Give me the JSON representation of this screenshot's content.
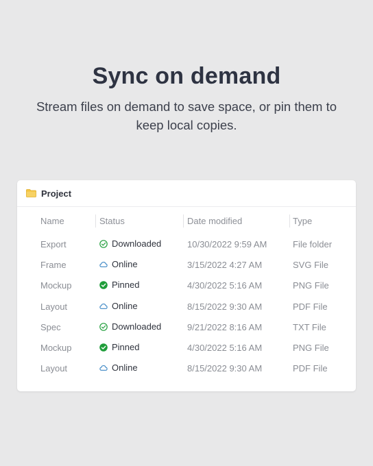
{
  "hero": {
    "title": "Sync on demand",
    "subtitle": "Stream files on demand to save space, or pin them to keep local copies."
  },
  "explorer": {
    "folder_name": "Project",
    "folder_icon": "folder-icon",
    "columns": [
      "Name",
      "Status",
      "Date modified",
      "Type"
    ],
    "rows": [
      {
        "name": "Export",
        "status": "Downloaded",
        "status_icon": "check-circle-outline-icon",
        "date": "10/30/2022 9:59 AM",
        "type": "File folder"
      },
      {
        "name": "Frame",
        "status": "Online",
        "status_icon": "cloud-icon",
        "date": "3/15/2022 4:27 AM",
        "type": "SVG File"
      },
      {
        "name": "Mockup",
        "status": "Pinned",
        "status_icon": "check-circle-filled-icon",
        "date": "4/30/2022 5:16 AM",
        "type": "PNG File"
      },
      {
        "name": "Layout",
        "status": "Online",
        "status_icon": "cloud-icon",
        "date": "8/15/2022 9:30 AM",
        "type": "PDF File"
      },
      {
        "name": "Spec",
        "status": "Downloaded",
        "status_icon": "check-circle-outline-icon",
        "date": "9/21/2022 8:16 AM",
        "type": "TXT File"
      },
      {
        "name": "Mockup",
        "status": "Pinned",
        "status_icon": "check-circle-filled-icon",
        "date": "4/30/2022 5:16 AM",
        "type": "PNG File"
      },
      {
        "name": "Layout",
        "status": "Online",
        "status_icon": "cloud-icon",
        "date": "8/15/2022 9:30 AM",
        "type": "PDF File"
      }
    ]
  },
  "colors": {
    "background": "#e8e8e9",
    "card": "#ffffff",
    "title": "#2e3342",
    "synced_green": "#1f9d3a",
    "cloud_blue": "#3b86c4",
    "folder_yellow": "#f4c542"
  }
}
